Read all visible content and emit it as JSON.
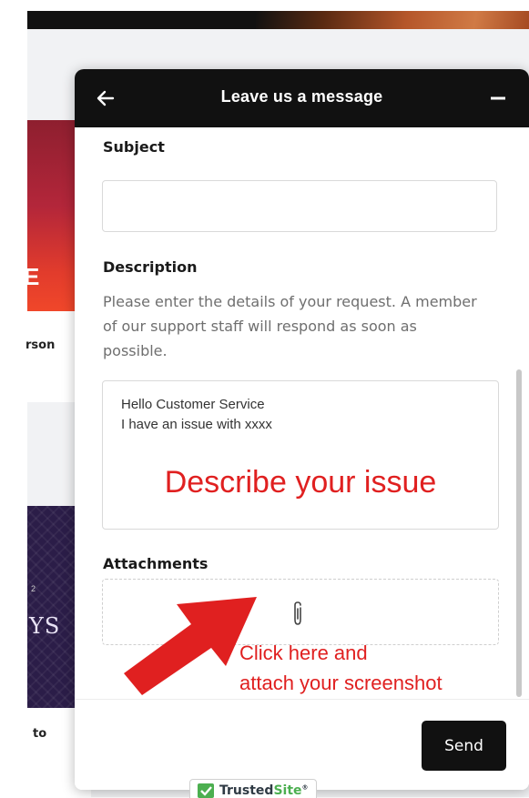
{
  "background": {
    "snippet_1": "rson",
    "snippet_2": "YS",
    "snippet_3": "to",
    "red_card_glyph": "E",
    "purple_card_tiny": "2"
  },
  "widget": {
    "title": "Leave us a message",
    "back_icon": "arrow-left-icon",
    "minimize_icon": "minus-icon"
  },
  "form": {
    "subject_label": "Subject",
    "subject_value": "",
    "description_label": "Description",
    "description_help": "Please enter the details of your request. A member of our support staff will respond as soon as possible.",
    "description_lines": [
      "Hello Customer Service",
      "I have an issue with xxxx"
    ],
    "attachments_label": "Attachments",
    "attach_icon": "paperclip-icon"
  },
  "annotations": {
    "describe": "Describe your issue",
    "attach_line_1": "Click here and",
    "attach_line_2": "attach your screenshot",
    "color": "#e02020"
  },
  "footer": {
    "send_label": "Send"
  },
  "badge": {
    "name_part_1": "Trusted",
    "name_part_2": "Site",
    "mark": "®"
  },
  "colors": {
    "header_bg": "#111111",
    "button_bg": "#111111",
    "annotation": "#e02020",
    "badge_green": "#4caf50"
  }
}
